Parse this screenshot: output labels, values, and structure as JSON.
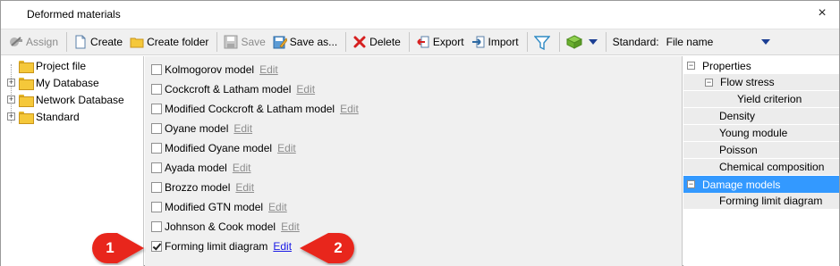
{
  "window": {
    "title": "Deformed materials",
    "close_glyph": "×"
  },
  "toolbar": {
    "assign": "Assign",
    "create": "Create",
    "create_folder": "Create folder",
    "save": "Save",
    "save_as": "Save as...",
    "delete": "Delete",
    "export": "Export",
    "import": "Import",
    "standard_label": "Standard:",
    "standard_value": "File name"
  },
  "tree": {
    "items": [
      {
        "label": "Project file",
        "icon": "folder-icon"
      },
      {
        "label": "My Database",
        "icon": "folder-icon"
      },
      {
        "label": "Network Database",
        "icon": "folder-icon"
      },
      {
        "label": "Standard",
        "icon": "folder-icon"
      }
    ]
  },
  "models": {
    "edit_label": "Edit",
    "items": [
      {
        "label": "Kolmogorov model",
        "checked": false
      },
      {
        "label": "Cockcroft & Latham model",
        "checked": false
      },
      {
        "label": "Modified Cockcroft & Latham model",
        "checked": false
      },
      {
        "label": "Oyane model",
        "checked": false
      },
      {
        "label": "Modified Oyane model",
        "checked": false
      },
      {
        "label": "Ayada model",
        "checked": false
      },
      {
        "label": "Brozzo model",
        "checked": false
      },
      {
        "label": "Modified GTN model",
        "checked": false
      },
      {
        "label": "Johnson & Cook model",
        "checked": false
      },
      {
        "label": "Forming limit diagram",
        "checked": true
      }
    ]
  },
  "properties": {
    "items": [
      {
        "label": "Properties"
      },
      {
        "label": "Flow stress"
      },
      {
        "label": "Yield criterion"
      },
      {
        "label": "Density"
      },
      {
        "label": "Young module"
      },
      {
        "label": "Poisson"
      },
      {
        "label": "Chemical composition"
      },
      {
        "label": "Damage models"
      },
      {
        "label": "Forming limit diagram"
      }
    ]
  },
  "callouts": {
    "one": "1",
    "two": "2",
    "color": "#e8261e"
  }
}
